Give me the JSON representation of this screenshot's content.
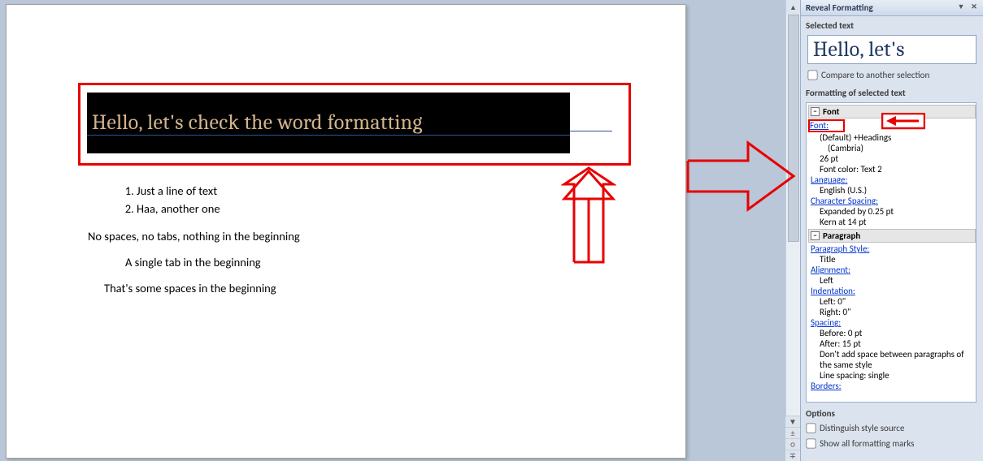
{
  "pane": {
    "title": "Reveal Formatting",
    "selectedTextLabel": "Selected text",
    "selectedTextSample": "Hello, let's",
    "compare": "Compare to another selection",
    "formattingLabel": "Formatting of selected text",
    "groups": {
      "fontGroup": "Font",
      "fontLink": "Font:",
      "fontDefault": "(Default) +Headings",
      "fontName": "(Cambria)",
      "fontSize": "26 pt",
      "fontColor": "Font color: Text 2",
      "languageLink": "Language:",
      "language": "English (U.S.)",
      "charSpacingLink": "Character Spacing:",
      "expanded": "Expanded by  0.25 pt",
      "kern": "Kern at 14 pt",
      "paragraphGroup": "Paragraph",
      "paraStyleLink": "Paragraph Style:",
      "paraStyle": "Title",
      "alignmentLink": "Alignment:",
      "alignment": "Left",
      "indentLink": "Indentation:",
      "indentLeft": "Left:  0\"",
      "indentRight": "Right:  0\"",
      "spacingLink": "Spacing:",
      "spaceBefore": "Before:  0 pt",
      "spaceAfter": "After:  15 pt",
      "dontAdd": "Don't add space between paragraphs of the same style",
      "lineSpacing": "Line spacing:  single",
      "bordersLink": "Borders:"
    },
    "optionsLabel": "Options",
    "optDist": "Distinguish style source",
    "optMarks": "Show all formatting marks"
  },
  "doc": {
    "title": "Hello, let's check the word formatting",
    "li1": "Just a line of text",
    "li2": "Haa, another one",
    "p1": "No spaces, no tabs, nothing in the beginning",
    "p2": "A single tab in the beginning",
    "p3": "That's some spaces in the beginning"
  }
}
